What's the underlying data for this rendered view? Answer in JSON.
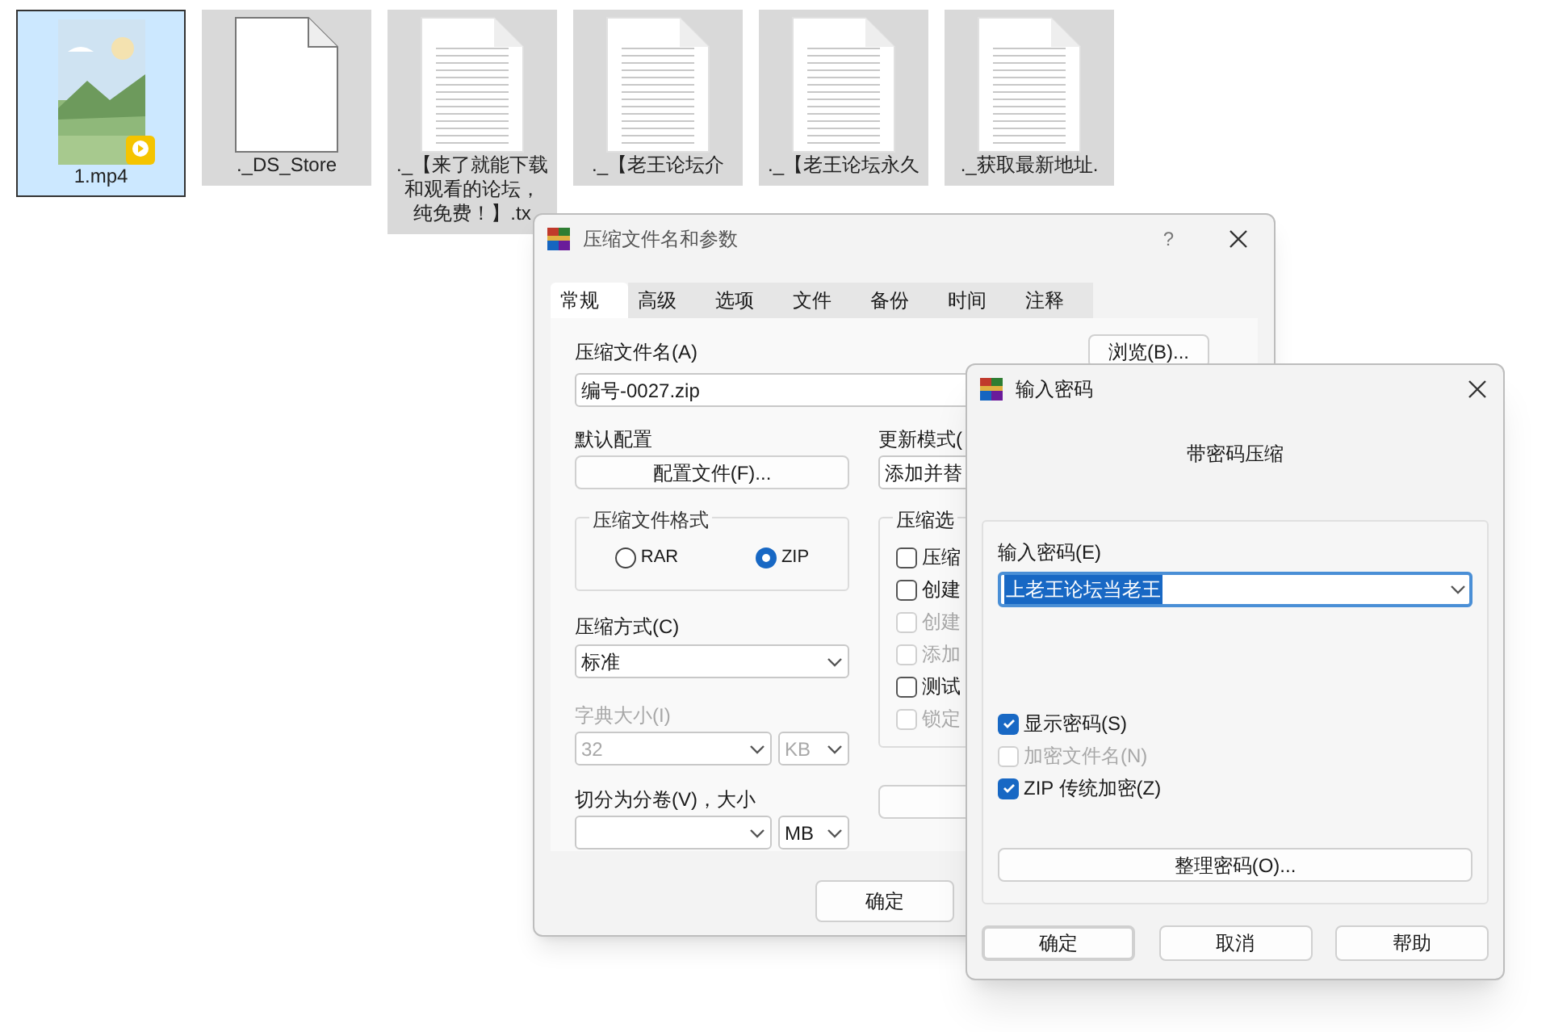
{
  "files": [
    {
      "kind": "video",
      "label_lines": [
        "1.mp4"
      ],
      "selected": true
    },
    {
      "kind": "blank",
      "label_lines": [
        "._DS_Store"
      ],
      "selected": false
    },
    {
      "kind": "text",
      "label_lines": [
        "._【来了就能下载",
        "和观看的论坛，",
        "纯免费！】.tx"
      ],
      "selected": false
    },
    {
      "kind": "text",
      "label_lines": [
        "._【老王论坛介"
      ],
      "selected": false
    },
    {
      "kind": "text",
      "label_lines": [
        "._【老王论坛永久"
      ],
      "selected": false
    },
    {
      "kind": "text",
      "label_lines": [
        "._获取最新地址."
      ],
      "selected": false
    }
  ],
  "archive_dialog": {
    "title": "压缩文件名和参数",
    "help": "?",
    "tabs": [
      {
        "label": "常规",
        "selected": true
      },
      {
        "label": "高级",
        "selected": false
      },
      {
        "label": "选项",
        "selected": false
      },
      {
        "label": "文件",
        "selected": false
      },
      {
        "label": "备份",
        "selected": false
      },
      {
        "label": "时间",
        "selected": false
      },
      {
        "label": "注释",
        "selected": false
      }
    ],
    "archive_name_label": "压缩文件名(A)",
    "browse_button": "浏览(B)...",
    "archive_name": "编号-0027.zip",
    "profile_label": "默认配置",
    "profile_button": "配置文件(F)...",
    "update_mode_label": "更新模式(",
    "update_mode": "添加并替",
    "format_group": {
      "title": "压缩文件格式",
      "options": [
        {
          "label": "RAR",
          "selected": false
        },
        {
          "label": "ZIP",
          "selected": true
        }
      ]
    },
    "method_label": "压缩方式(C)",
    "method": "标准",
    "dict_label": "字典大小(I)",
    "dict_size": "32",
    "dict_unit": "KB",
    "split_label": "切分为分卷(V)，大小",
    "split_unit": "MB",
    "options_group": {
      "title": "压缩选",
      "items": [
        {
          "label": "压缩",
          "checked": false,
          "disabled": false
        },
        {
          "label": "创建",
          "checked": false,
          "disabled": false
        },
        {
          "label": "创建",
          "checked": false,
          "disabled": true
        },
        {
          "label": "添加",
          "checked": false,
          "disabled": true
        },
        {
          "label": "测试",
          "checked": false,
          "disabled": false
        },
        {
          "label": "锁定",
          "checked": false,
          "disabled": true
        }
      ]
    },
    "ok_button": "确定"
  },
  "password_dialog": {
    "title": "输入密码",
    "heading": "带密码压缩",
    "password_label": "输入密码(E)",
    "password": "上老王论坛当老王",
    "password_highlighted": true,
    "options": [
      {
        "label": "显示密码(S)",
        "checked": true,
        "disabled": false
      },
      {
        "label": "加密文件名(N)",
        "checked": false,
        "disabled": true
      },
      {
        "label": "ZIP 传统加密(Z)",
        "checked": true,
        "disabled": false
      }
    ],
    "organize_button": "整理密码(O)...",
    "buttons": [
      {
        "label": "确定",
        "default": true
      },
      {
        "label": "取消",
        "default": false
      },
      {
        "label": "帮助",
        "default": false
      }
    ]
  }
}
